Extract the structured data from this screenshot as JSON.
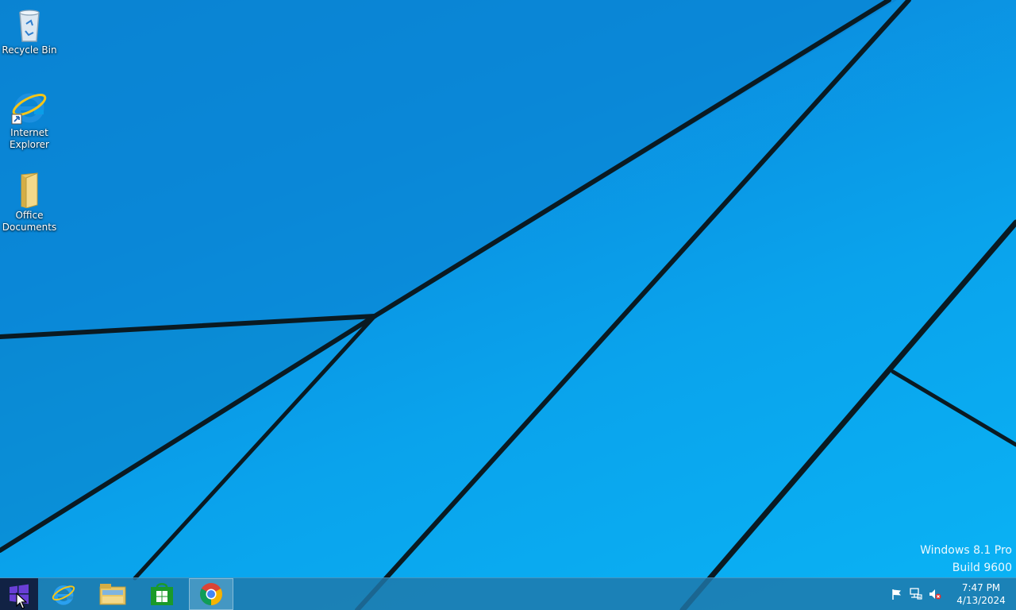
{
  "desktop": {
    "icons": [
      {
        "label": "Recycle Bin",
        "icon": "recycle-bin-icon"
      },
      {
        "label": "Internet\nExplorer",
        "icon": "internet-explorer-icon"
      },
      {
        "label": "Office\nDocuments",
        "icon": "folder-icon"
      }
    ]
  },
  "watermark": {
    "line1": "Windows 8.1 Pro",
    "line2": "Build 9600"
  },
  "taskbar": {
    "start_icon": "windows-logo-icon",
    "pinned": [
      {
        "name": "Internet Explorer",
        "icon": "internet-explorer-icon"
      },
      {
        "name": "File Explorer",
        "icon": "file-explorer-icon"
      },
      {
        "name": "Store",
        "icon": "store-icon"
      },
      {
        "name": "Google Chrome",
        "icon": "chrome-icon",
        "active": true
      }
    ],
    "tray": {
      "icons": [
        "action-center-flag-icon",
        "network-icon",
        "volume-muted-icon"
      ],
      "time": "7:47 PM",
      "date": "4/13/2024"
    }
  },
  "colors": {
    "wallpaper": "#0a9ee8",
    "taskbar": "#2078aa",
    "start": "#112244"
  }
}
